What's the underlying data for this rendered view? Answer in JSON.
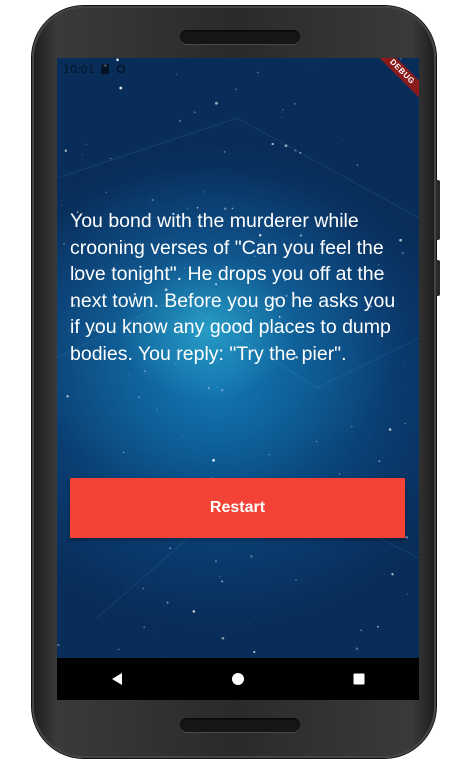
{
  "status_bar": {
    "time": "10:01",
    "icons": [
      "sd-card-icon",
      "sync-icon"
    ]
  },
  "debug_banner": "DEBUG",
  "story": {
    "text": "You bond with the murderer while crooning verses of \"Can you feel the love tonight\". He drops you off at the next town. Before you go he asks you if you know any good places to dump bodies. You reply: \"Try the pier\"."
  },
  "actions": {
    "restart_label": "Restart"
  },
  "navigation": {
    "buttons": [
      "back-icon",
      "home-icon",
      "recents-icon"
    ]
  },
  "colors": {
    "button": "#f44336",
    "screen_center": "#3cd2f0",
    "screen_edge": "#082d58",
    "nav_bar": "#000000"
  }
}
